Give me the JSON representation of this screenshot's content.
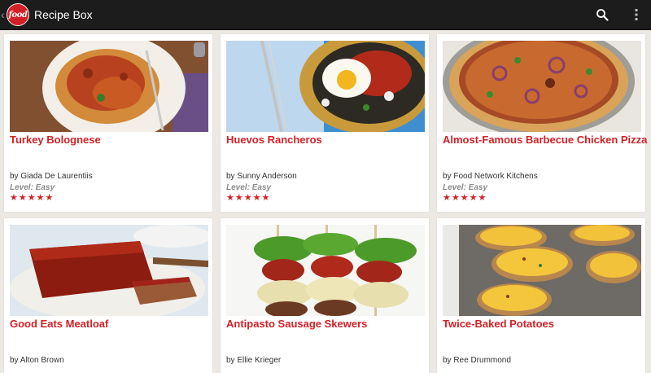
{
  "app": {
    "logo_text": "food",
    "title": "Recipe Box"
  },
  "toolbar": {
    "search_icon": "search-icon",
    "overflow_icon": "overflow-menu-icon"
  },
  "colors": {
    "accent": "#d32027",
    "actionbar": "#1c1c1c",
    "background": "#ece9e4"
  },
  "recipes": [
    {
      "title": "Turkey Bolognese",
      "author": "by Giada De Laurentiis",
      "level": "Level: Easy",
      "rating": 5
    },
    {
      "title": "Huevos Rancheros",
      "author": "by Sunny Anderson",
      "level": "Level: Easy",
      "rating": 5
    },
    {
      "title": "Almost-Famous Barbecue Chicken Pizza",
      "author": "by Food Network Kitchens",
      "level": "Level: Easy",
      "rating": 5
    },
    {
      "title": "Good Eats Meatloaf",
      "author": "by Alton Brown"
    },
    {
      "title": "Antipasto Sausage Skewers",
      "author": "by Ellie Krieger"
    },
    {
      "title": "Twice-Baked Potatoes",
      "author": "by Ree Drummond"
    }
  ]
}
